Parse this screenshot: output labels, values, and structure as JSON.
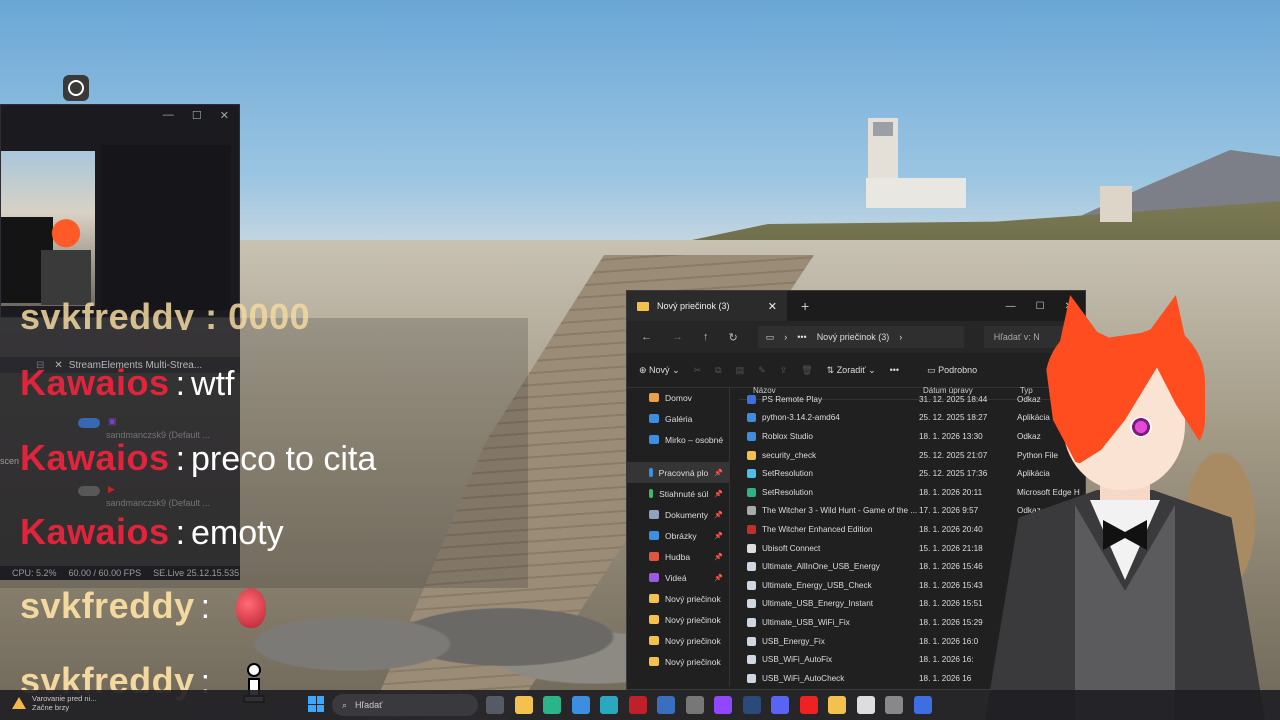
{
  "obs": {
    "window_controls": [
      "—",
      "☐",
      "✕"
    ]
  },
  "streamelements": {
    "tab_label": "StreamElements Multi-Strea...",
    "accounts": [
      {
        "name": "sandmanczsk9 (Default ..."
      },
      {
        "name": "sandmanczsk9 (Default ..."
      }
    ],
    "side_label": "scen",
    "status_cpu": "CPU: 5.2%",
    "status_fps": "60.00 / 60.00 FPS",
    "status_version": "SE.Live 25.12.15.535"
  },
  "chat": {
    "partial_text": "svkfreddy : 0000",
    "separator": ":",
    "messages": [
      {
        "user": "Kawaios",
        "text": "wtf"
      },
      {
        "user": "Kawaios",
        "text": "preco to cita"
      },
      {
        "user": "Kawaios",
        "text": "emoty"
      },
      {
        "user": "svkfreddy",
        "text": ""
      },
      {
        "user": "svkfreddy",
        "text": ""
      }
    ],
    "colors": {
      "kawaios": "#e0243c",
      "svkfreddy": "#f3d9a0"
    }
  },
  "explorer": {
    "tab_title": "Nový priečinok (3)",
    "address": "Nový priečinok (3)",
    "search_placeholder": "Hľadať v: N",
    "toolbar": {
      "new": "Nový",
      "sort": "Zoradiť",
      "more": "•••",
      "details": "Podrobno"
    },
    "nav": [
      {
        "label": "Domov",
        "icon": "home-icon",
        "color": "#e8a04a"
      },
      {
        "label": "Galéria",
        "icon": "gallery-icon",
        "color": "#3d8de0"
      },
      {
        "label": "Mirko – osobné",
        "icon": "cloud-icon",
        "color": "#3d8de0"
      },
      {
        "label": "Pracovná plo",
        "icon": "desktop-icon",
        "color": "#3d8de0"
      },
      {
        "label": "Stiahnuté súl",
        "icon": "download-icon",
        "color": "#3fb968"
      },
      {
        "label": "Dokumenty",
        "icon": "documents-icon",
        "color": "#8da3bf"
      },
      {
        "label": "Obrázky",
        "icon": "pictures-icon",
        "color": "#3d8de0"
      },
      {
        "label": "Hudba",
        "icon": "music-icon",
        "color": "#e0553d"
      },
      {
        "label": "Videá",
        "icon": "videos-icon",
        "color": "#9a5be0"
      },
      {
        "label": "Nový priečinok",
        "icon": "folder-icon",
        "color": "#f2c14e"
      },
      {
        "label": "Nový priečinok",
        "icon": "folder-icon",
        "color": "#f2c14e"
      },
      {
        "label": "Nový priečinok",
        "icon": "folder-icon",
        "color": "#f2c14e"
      },
      {
        "label": "Nový priečinok",
        "icon": "folder-icon",
        "color": "#f2c14e"
      }
    ],
    "columns": {
      "name": "Názov",
      "date": "Dátum úpravy",
      "type": "Typ"
    },
    "files": [
      {
        "name": "PS Remote Play",
        "date": "31. 12. 2025 18:44",
        "type": "Odkaz",
        "color": "#3d6fe0"
      },
      {
        "name": "python-3.14.2-amd64",
        "date": "25. 12. 2025 18:27",
        "type": "Aplikácia",
        "color": "#3d8de0"
      },
      {
        "name": "Roblox Studio",
        "date": "18. 1. 2026 13:30",
        "type": "Odkaz",
        "color": "#3d8de0"
      },
      {
        "name": "security_check",
        "date": "25. 12. 2025 21:07",
        "type": "Python File",
        "color": "#f2c14e"
      },
      {
        "name": "SetResolution",
        "date": "25. 12. 2025 17:36",
        "type": "Aplikácia",
        "color": "#4ac0e8"
      },
      {
        "name": "SetResolution",
        "date": "18. 1. 2026 20:11",
        "type": "Microsoft Edge H",
        "color": "#2ab48a"
      },
      {
        "name": "The Witcher 3 - Wild Hunt - Game of the ...",
        "date": "17. 1. 2026 9:57",
        "type": "Odkaz",
        "color": "#aaaaaa"
      },
      {
        "name": "The Witcher Enhanced Edition",
        "date": "18. 1. 2026 20:40",
        "type": "Int",
        "color": "#c0302a"
      },
      {
        "name": "Ubisoft Connect",
        "date": "15. 1. 2026 21:18",
        "type": "",
        "color": "#dddddd"
      },
      {
        "name": "Ultimate_AllInOne_USB_Energy",
        "date": "18. 1. 2026 15:46",
        "type": "",
        "color": "#cfd8e0"
      },
      {
        "name": "Ultimate_Energy_USB_Check",
        "date": "18. 1. 2026 15:43",
        "type": "",
        "color": "#cfd8e0"
      },
      {
        "name": "Ultimate_USB_Energy_Instant",
        "date": "18. 1. 2026 15:51",
        "type": "",
        "color": "#cfd8e0"
      },
      {
        "name": "Ultimate_USB_WiFi_Fix",
        "date": "18. 1. 2026 15:29",
        "type": "",
        "color": "#cfd8e0"
      },
      {
        "name": "USB_Energy_Fix",
        "date": "18. 1. 2026 16:0",
        "type": "",
        "color": "#cfd8e0"
      },
      {
        "name": "USB_WiFi_AutoFix",
        "date": "18. 1. 2026 16:",
        "type": "",
        "color": "#cfd8e0"
      },
      {
        "name": "USB_WiFi_AutoCheck",
        "date": "18. 1. 2026 16",
        "type": "",
        "color": "#cfd8e0"
      }
    ]
  },
  "taskbar": {
    "warning_line1": "Varovanie pred ni...",
    "warning_line2": "Začne brzy",
    "search_placeholder": "Hľadať",
    "apps": [
      {
        "icon": "task-view-icon",
        "color": "#555a66"
      },
      {
        "icon": "file-explorer-icon",
        "color": "#f2c14e"
      },
      {
        "icon": "edge-icon",
        "color": "#2ab48a"
      },
      {
        "icon": "store-icon",
        "color": "#3d8de0"
      },
      {
        "icon": "app-icon",
        "color": "#2aa8c0"
      },
      {
        "icon": "amd-icon",
        "color": "#c0202a"
      },
      {
        "icon": "vegas-icon",
        "color": "#3a6fc0"
      },
      {
        "icon": "gear-app-icon",
        "color": "#777"
      },
      {
        "icon": "twitch-icon",
        "color": "#9146ff"
      },
      {
        "icon": "steam-icon",
        "color": "#2a4a7a"
      },
      {
        "icon": "discord-icon",
        "color": "#5865f2"
      },
      {
        "icon": "youtube-icon",
        "color": "#e22"
      },
      {
        "icon": "chrome-icon",
        "color": "#f2c14e"
      },
      {
        "icon": "vpn-icon",
        "color": "#ddd"
      },
      {
        "icon": "obs-icon",
        "color": "#888"
      },
      {
        "icon": "window-app-icon",
        "color": "#3d6fe0"
      }
    ]
  }
}
